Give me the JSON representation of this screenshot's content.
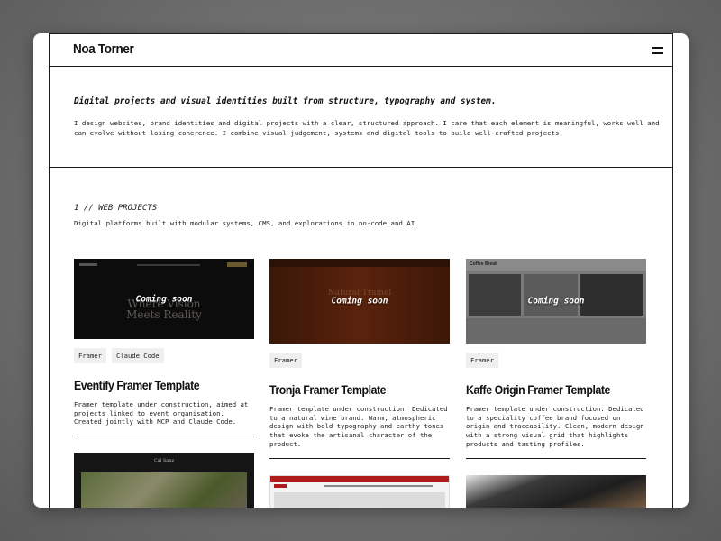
{
  "header": {
    "brand": "Noa Torner"
  },
  "intro": {
    "tagline": "Digital projects and visual identities built from structure, typography and system.",
    "body": "I design websites, brand identities and digital projects with a clear, structured approach. I care that each element is meaningful, works well and can evolve without losing coherence. I combine visual judgement, systems and digital tools to build well-crafted projects."
  },
  "section": {
    "title": "1 // WEB PROJECTS",
    "description": "Digital platforms built with modular systems, CMS, and explorations in no-code and AI."
  },
  "cards": [
    {
      "overlay": "Coming soon",
      "thumb_text": "Where Vision Meets Reality",
      "tags": [
        "Framer",
        "Claude Code"
      ],
      "title": "Eventify Framer Template",
      "description": "Framer template under construction, aimed at projects linked to event organisation. Created jointly with MCP and Claude Code."
    },
    {
      "overlay": "Coming soon",
      "thumb_text": "Natural Tramel",
      "tags": [
        "Framer"
      ],
      "title": "Tronja Framer Template",
      "description": "Framer template under construction. Dedicated to a natural wine brand. Warm, atmospheric design with bold typography and earthy tones that evoke the artisanal character of the product."
    },
    {
      "overlay": "Coming soon",
      "thumb_text": "Coffee Break",
      "tags": [
        "Framer"
      ],
      "title": "Kaffe Origin Framer Template",
      "description": "Framer template under construction. Dedicated to a speciality coffee brand focused on origin and traceability. Clean, modern design with a strong visual grid that highlights products and tasting profiles."
    }
  ],
  "next_cards": [
    {
      "thumb_text": "Cal Sanz"
    },
    {
      "thumb_text": ""
    },
    {
      "thumb_text": ""
    }
  ]
}
